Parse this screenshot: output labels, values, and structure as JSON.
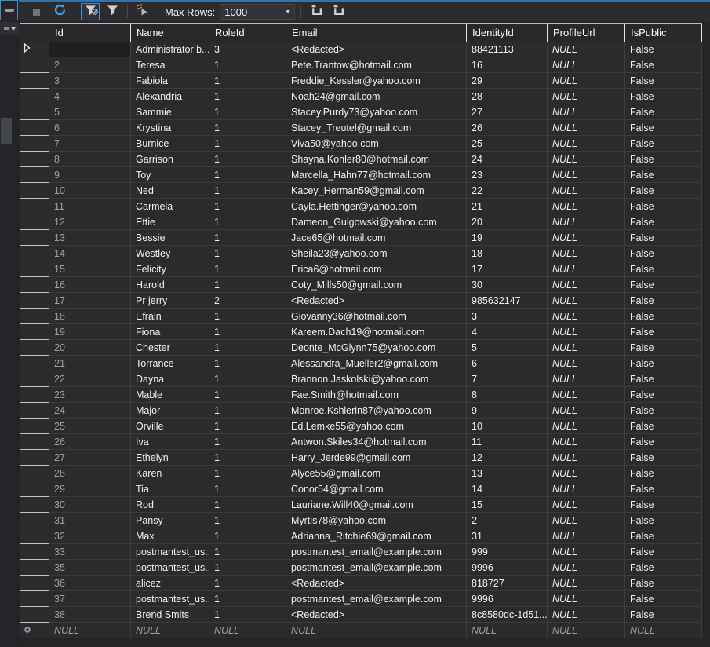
{
  "colors": {
    "accent_blue_border": "#3393df",
    "top_accent_line": "#2e74ae",
    "refresh_icon_blue": "#3fa2e6",
    "sparkle_gold": "#e0a53f",
    "grid_background": "#2b2b2d",
    "header_text": "#ffffff",
    "cell_text": "#f1f1f1",
    "muted_text": "#9fa0a3"
  },
  "toolbar": {
    "icons": [
      "stop-icon",
      "refresh-icon",
      "filter-remove-icon",
      "filter-icon",
      "script-changes-icon",
      "sql-pane-icon",
      "sql-pane-icon"
    ],
    "max_rows_label": "Max Rows:",
    "max_rows_value": "1000"
  },
  "grid": {
    "columns": [
      "",
      "Id",
      "Name",
      "RoleId",
      "Email",
      "IdentityId",
      "ProfileUrl",
      "IsPublic"
    ],
    "current_row_indicator": "triangle-right",
    "new_row_indicator": "circle",
    "rows": [
      [
        "",
        "Administrator b...",
        "3",
        "<Redacted>",
        "88421113",
        "NULL",
        "False"
      ],
      [
        "2",
        "Teresa",
        "1",
        "Pete.Trantow@hotmail.com",
        "16",
        "NULL",
        "False"
      ],
      [
        "3",
        "Fabiola",
        "1",
        "Freddie_Kessler@yahoo.com",
        "29",
        "NULL",
        "False"
      ],
      [
        "4",
        "Alexandria",
        "1",
        "Noah24@gmail.com",
        "28",
        "NULL",
        "False"
      ],
      [
        "5",
        "Sammie",
        "1",
        "Stacey.Purdy73@yahoo.com",
        "27",
        "NULL",
        "False"
      ],
      [
        "6",
        "Krystina",
        "1",
        "Stacey_Treutel@gmail.com",
        "26",
        "NULL",
        "False"
      ],
      [
        "7",
        "Burnice",
        "1",
        "Viva50@yahoo.com",
        "25",
        "NULL",
        "False"
      ],
      [
        "8",
        "Garrison",
        "1",
        "Shayna.Kohler80@hotmail.com",
        "24",
        "NULL",
        "False"
      ],
      [
        "9",
        "Toy",
        "1",
        "Marcella_Hahn77@hotmail.com",
        "23",
        "NULL",
        "False"
      ],
      [
        "10",
        "Ned",
        "1",
        "Kacey_Herman59@gmail.com",
        "22",
        "NULL",
        "False"
      ],
      [
        "11",
        "Carmela",
        "1",
        "Cayla.Hettinger@yahoo.com",
        "21",
        "NULL",
        "False"
      ],
      [
        "12",
        "Ettie",
        "1",
        "Dameon_Gulgowski@yahoo.com",
        "20",
        "NULL",
        "False"
      ],
      [
        "13",
        "Bessie",
        "1",
        "Jace65@hotmail.com",
        "19",
        "NULL",
        "False"
      ],
      [
        "14",
        "Westley",
        "1",
        "Sheila23@yahoo.com",
        "18",
        "NULL",
        "False"
      ],
      [
        "15",
        "Felicity",
        "1",
        "Erica6@hotmail.com",
        "17",
        "NULL",
        "False"
      ],
      [
        "16",
        "Harold",
        "1",
        "Coty_Mills50@gmail.com",
        "30",
        "NULL",
        "False"
      ],
      [
        "17",
        "Pr jerry",
        "2",
        "<Redacted>",
        "985632147",
        "NULL",
        "False"
      ],
      [
        "18",
        "Efrain",
        "1",
        "Giovanny36@hotmail.com",
        "3",
        "NULL",
        "False"
      ],
      [
        "19",
        "Fiona",
        "1",
        "Kareem.Dach19@hotmail.com",
        "4",
        "NULL",
        "False"
      ],
      [
        "20",
        "Chester",
        "1",
        "Deonte_McGlynn75@yahoo.com",
        "5",
        "NULL",
        "False"
      ],
      [
        "21",
        "Torrance",
        "1",
        "Alessandra_Mueller2@gmail.com",
        "6",
        "NULL",
        "False"
      ],
      [
        "22",
        "Dayna",
        "1",
        "Brannon.Jaskolski@yahoo.com",
        "7",
        "NULL",
        "False"
      ],
      [
        "23",
        "Mable",
        "1",
        "Fae.Smith@hotmail.com",
        "8",
        "NULL",
        "False"
      ],
      [
        "24",
        "Major",
        "1",
        "Monroe.Kshlerin87@yahoo.com",
        "9",
        "NULL",
        "False"
      ],
      [
        "25",
        "Orville",
        "1",
        "Ed.Lemke55@yahoo.com",
        "10",
        "NULL",
        "False"
      ],
      [
        "26",
        "Iva",
        "1",
        "Antwon.Skiles34@hotmail.com",
        "11",
        "NULL",
        "False"
      ],
      [
        "27",
        "Ethelyn",
        "1",
        "Harry_Jerde99@gmail.com",
        "12",
        "NULL",
        "False"
      ],
      [
        "28",
        "Karen",
        "1",
        "Alyce55@gmail.com",
        "13",
        "NULL",
        "False"
      ],
      [
        "29",
        "Tia",
        "1",
        "Conor54@gmail.com",
        "14",
        "NULL",
        "False"
      ],
      [
        "30",
        "Rod",
        "1",
        "Lauriane.Will40@gmail.com",
        "15",
        "NULL",
        "False"
      ],
      [
        "31",
        "Pansy",
        "1",
        "Myrtis78@yahoo.com",
        "2",
        "NULL",
        "False"
      ],
      [
        "32",
        "Max",
        "1",
        "Adrianna_Ritchie69@gmail.com",
        "31",
        "NULL",
        "False"
      ],
      [
        "33",
        "postmantest_us...",
        "1",
        "postmantest_email@example.com",
        "999",
        "NULL",
        "False"
      ],
      [
        "35",
        "postmantest_us...",
        "1",
        "postmantest_email@example.com",
        "9996",
        "NULL",
        "False"
      ],
      [
        "36",
        "alicez",
        "1",
        "<Redacted>",
        "818727",
        "NULL",
        "False"
      ],
      [
        "37",
        "postmantest_us...",
        "1",
        "postmantest_email@example.com",
        "9996",
        "NULL",
        "False"
      ],
      [
        "38",
        "Brend Smits",
        "1",
        "<Redacted>",
        "8c8580dc-1d51...",
        "NULL",
        "False"
      ],
      [
        "NULL",
        "NULL",
        "NULL",
        "NULL",
        "NULL",
        "NULL",
        "NULL"
      ]
    ]
  }
}
